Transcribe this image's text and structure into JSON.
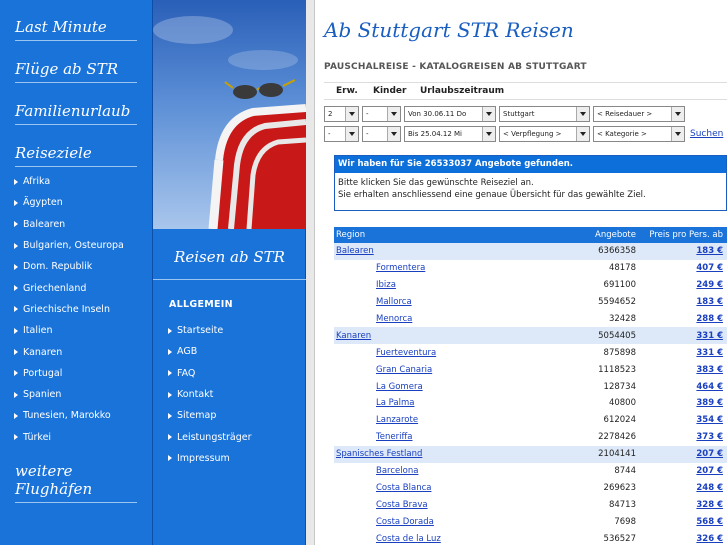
{
  "left_nav": {
    "last_minute": "Last Minute",
    "fluege": "Flüge ab STR",
    "familienurlaub": "Familienurlaub",
    "reiseziele": "Reiseziele",
    "destinations": [
      "Afrika",
      "Ägypten",
      "Balearen",
      "Bulgarien, Osteuropa",
      "Dom. Republik",
      "Griechenland",
      "Griechische Inseln",
      "Italien",
      "Kanaren",
      "Portugal",
      "Spanien",
      "Tunesien, Marokko",
      "Türkei"
    ],
    "weitere": "weitere Flughäfen"
  },
  "middle": {
    "photo_title": "Reisen ab STR",
    "section_title": "ALLGEMEIN",
    "menu": [
      "Startseite",
      "AGB",
      "FAQ",
      "Kontakt",
      "Sitemap",
      "Leistungsträger",
      "Impressum"
    ]
  },
  "main": {
    "title": "Ab Stuttgart STR Reisen",
    "subtitle": "PAUSCHALREISE - KATALOGREISEN AB STUTTGART",
    "search_headers": {
      "erw": "Erw.",
      "kinder": "Kinder",
      "zeitraum": "Urlaubszeitraum"
    },
    "row1": {
      "erw": "2",
      "kinder": "-",
      "date": "Von 30.06.11 Do",
      "city": "Stuttgart",
      "duration": "< Reisedauer >"
    },
    "row2": {
      "erw": "-",
      "kinder": "-",
      "date": "Bis 25.04.12 Mi",
      "board": "< Verpflegung >",
      "category": "< Kategorie >",
      "search": "Suchen"
    },
    "result_head": "Wir haben für Sie 26533037 Angebote gefunden.",
    "result_line1": "Bitte klicken Sie das gewünschte Reiseziel an.",
    "result_line2": "Sie erhalten anschliessend eine genaue Übersicht für das gewählte Ziel.",
    "table_headers": {
      "region": "Region",
      "offers": "Angebote",
      "price": "Preis pro Pers. ab"
    },
    "rows": [
      {
        "name": "Balearen",
        "offers": "6366358",
        "price": "183 €",
        "region": true
      },
      {
        "name": "Formentera",
        "offers": "48178",
        "price": "407 €",
        "region": false
      },
      {
        "name": "Ibiza",
        "offers": "691100",
        "price": "249 €",
        "region": false
      },
      {
        "name": "Mallorca",
        "offers": "5594652",
        "price": "183 €",
        "region": false
      },
      {
        "name": "Menorca",
        "offers": "32428",
        "price": "288 €",
        "region": false
      },
      {
        "name": "Kanaren",
        "offers": "5054405",
        "price": "331 €",
        "region": true
      },
      {
        "name": "Fuerteventura",
        "offers": "875898",
        "price": "331 €",
        "region": false
      },
      {
        "name": "Gran Canaria",
        "offers": "1118523",
        "price": "383 €",
        "region": false
      },
      {
        "name": "La Gomera",
        "offers": "128734",
        "price": "464 €",
        "region": false
      },
      {
        "name": "La Palma",
        "offers": "40800",
        "price": "389 €",
        "region": false
      },
      {
        "name": "Lanzarote",
        "offers": "612024",
        "price": "354 €",
        "region": false
      },
      {
        "name": "Teneriffa",
        "offers": "2278426",
        "price": "373 €",
        "region": false
      },
      {
        "name": "Spanisches Festland",
        "offers": "2104141",
        "price": "207 €",
        "region": true
      },
      {
        "name": "Barcelona",
        "offers": "8744",
        "price": "207 €",
        "region": false
      },
      {
        "name": "Costa Blanca",
        "offers": "269623",
        "price": "248 €",
        "region": false
      },
      {
        "name": "Costa Brava",
        "offers": "84713",
        "price": "328 €",
        "region": false
      },
      {
        "name": "Costa Dorada",
        "offers": "7698",
        "price": "568 €",
        "region": false
      },
      {
        "name": "Costa de la Luz",
        "offers": "536527",
        "price": "326 €",
        "region": false
      }
    ]
  },
  "colors": {
    "nav_blue": "#1a73d9",
    "title_blue": "#1a5fc0",
    "link_blue": "#1a40c0",
    "region_row": "#dde9f8"
  }
}
